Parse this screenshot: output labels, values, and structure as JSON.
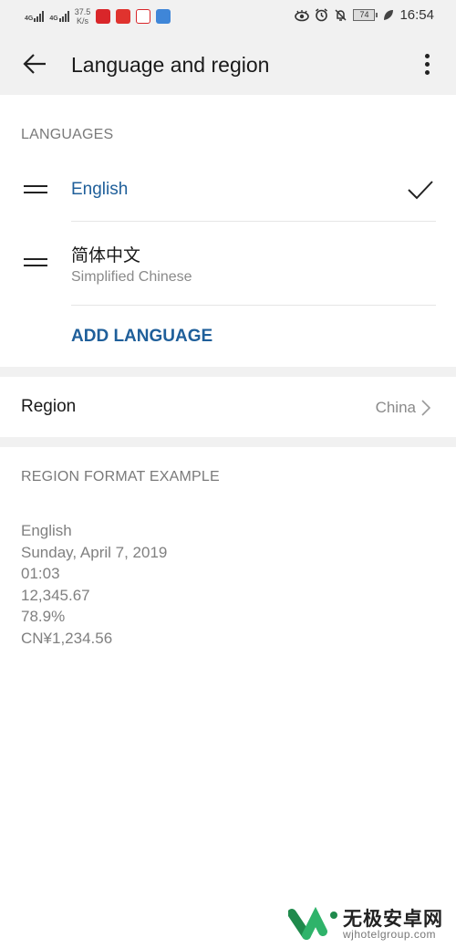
{
  "status_bar": {
    "network_1": "4G",
    "network_2": "4G",
    "speed_value": "37.5",
    "speed_unit": "K/s",
    "battery": "74",
    "time": "16:54",
    "icons": [
      "eye-comfort-icon",
      "alarm-icon",
      "mute-icon",
      "battery-icon",
      "leaf-icon"
    ]
  },
  "app_bar": {
    "title": "Language and region",
    "back_icon": "arrow-left-icon",
    "menu_icon": "more-vertical-icon"
  },
  "languages": {
    "header": "LANGUAGES",
    "items": [
      {
        "label": "English",
        "subtitle": "",
        "selected": true
      },
      {
        "label": "简体中文",
        "subtitle": "Simplified Chinese",
        "selected": false
      }
    ],
    "add_label": "ADD LANGUAGE"
  },
  "region": {
    "label": "Region",
    "value": "China"
  },
  "format_example": {
    "header": "REGION FORMAT EXAMPLE",
    "lines": [
      "English",
      "Sunday, April 7, 2019",
      "01:03",
      "12,345.67",
      "78.9%",
      "CN¥1,234.56"
    ]
  },
  "watermark": {
    "name": "无极安卓网",
    "url": "wjhotelgroup.com"
  },
  "colors": {
    "accent": "#1f5f9a",
    "background_gray": "#f1f1f1"
  }
}
